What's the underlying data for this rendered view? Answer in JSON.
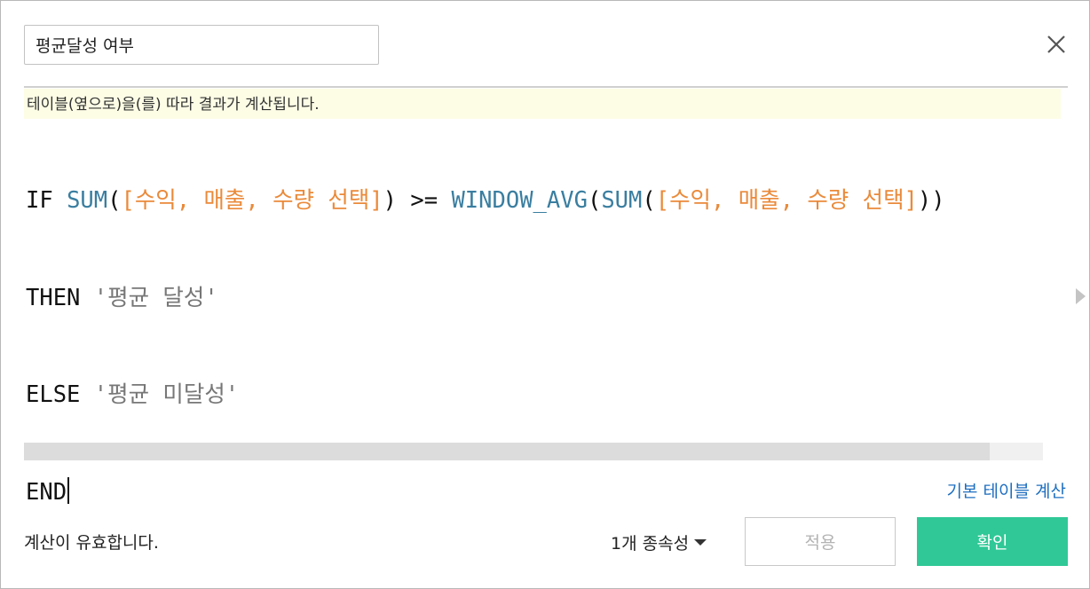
{
  "dialog": {
    "calc_name": "평균달성 여부",
    "close_icon": "close-icon"
  },
  "hint": {
    "text": "테이블(옆으로)을(를) 따라 결과가 계산됩니다."
  },
  "formula": {
    "line1": {
      "kw_if": "IF",
      "fn_sum1": "SUM",
      "p1_open": "(",
      "field1": "[수익, 매출, 수량 선택]",
      "p1_close": ")",
      "op_gte": " >= ",
      "fn_window_avg": "WINDOW_AVG",
      "p2_open": "(",
      "fn_sum2": "SUM",
      "p3_open": "(",
      "field2": "[수익, 매출, 수량 선택]",
      "p3_close": ")",
      "p2_close": ")"
    },
    "line2": {
      "kw_then": "THEN",
      "str_then": "'평균 달성'"
    },
    "line3": {
      "kw_else": "ELSE",
      "str_else": "'평균 미달성'"
    },
    "line4": {
      "kw_end": "END"
    }
  },
  "links": {
    "default_table_calc": "기본 테이블 계산"
  },
  "footer": {
    "status": "계산이 유효합니다.",
    "dependencies": "1개 종속성",
    "apply_label": "적용",
    "ok_label": "확인"
  },
  "colors": {
    "function": "#3a7ea0",
    "field": "#ea8a3a",
    "string": "#777777",
    "ok_button": "#2fc896",
    "link": "#1f6fc0",
    "hint_background": "#fdfde6"
  },
  "icons": {
    "close": "close-icon",
    "expand_side": "triangle-right-icon",
    "dropdown": "caret-down-icon"
  }
}
